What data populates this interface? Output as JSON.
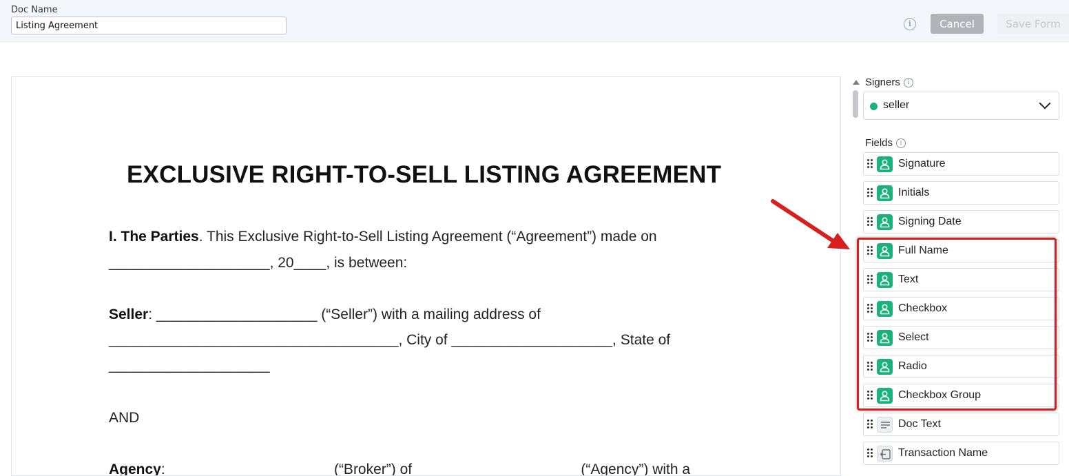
{
  "header": {
    "doc_name_label": "Doc Name",
    "doc_name_value": "Listing Agreement",
    "cancel_label": "Cancel",
    "save_label": "Save Form"
  },
  "document": {
    "title": "EXCLUSIVE RIGHT-TO-SELL LISTING AGREEMENT",
    "parties_heading": "I. The Parties",
    "parties_text": ". This Exclusive Right-to-Sell Listing Agreement (“Agreement”) made on",
    "date_line": "____________________, 20____, is between:",
    "seller_heading": "Seller",
    "seller_text": ": ____________________ (“Seller”) with a mailing address of",
    "address_line": "____________________________________, City of ____________________, State of",
    "state_line": "____________________",
    "and_text": "AND",
    "agency_heading": "Agency",
    "agency_text": ": ____________________ (“Broker”) of ____________________ (“Agency”) with a"
  },
  "sidebar": {
    "signers_label": "Signers",
    "selected_signer": "seller",
    "signer_color": "#1bb27b",
    "fields_label": "Fields",
    "fields": [
      {
        "label": "Signature",
        "icon": "person-icon"
      },
      {
        "label": "Initials",
        "icon": "person-icon"
      },
      {
        "label": "Signing Date",
        "icon": "person-icon"
      },
      {
        "label": "Full Name",
        "icon": "person-icon"
      },
      {
        "label": "Text",
        "icon": "person-icon"
      },
      {
        "label": "Checkbox",
        "icon": "person-icon"
      },
      {
        "label": "Select",
        "icon": "person-icon"
      },
      {
        "label": "Radio",
        "icon": "person-icon"
      },
      {
        "label": "Checkbox Group",
        "icon": "person-icon"
      },
      {
        "label": "Doc Text",
        "icon": "text-lines-icon"
      },
      {
        "label": "Transaction Name",
        "icon": "transaction-icon"
      }
    ]
  },
  "annotation": {
    "highlight_color": "#d81e1e"
  }
}
